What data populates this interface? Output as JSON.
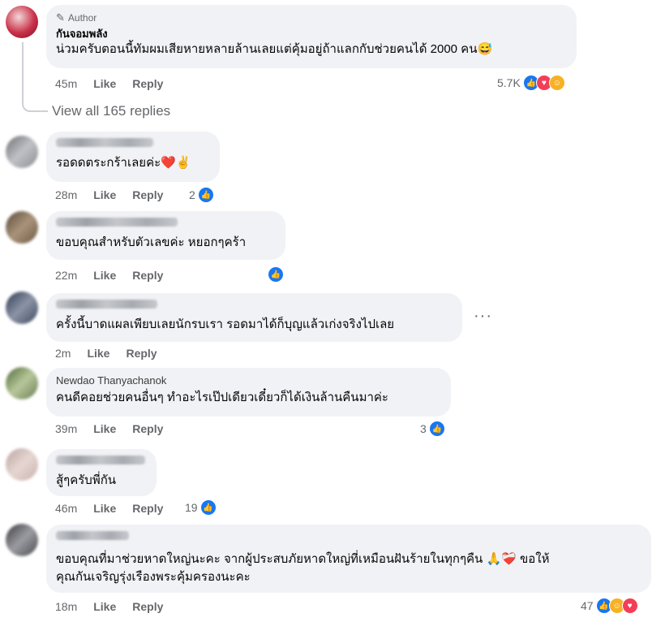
{
  "top_comment": {
    "author_tag": "Author",
    "author_name": "กันจอมพลัง",
    "text": "น่วมครับตอนนี้ทัมผมเสียหายหลายล้านเลยแต่คุ้มอยู่ถ้าแลกกับช่วยคนได้ 2000 คน😅",
    "time": "45m",
    "like_label": "Like",
    "reply_label": "Reply",
    "reaction_count": "5.7K",
    "reaction_icons": [
      "like-icon",
      "love-icon",
      "care-icon"
    ]
  },
  "view_replies": "View all 165 replies",
  "comments": [
    {
      "text": "รอดดตระกร้าเลยค่ะ❤️✌️",
      "time": "28m",
      "like": "Like",
      "reply": "Reply",
      "reaction_count": "2"
    },
    {
      "text": "ขอบคุณสำหรับตัวเลขค่ะ หยอกๆคร้า",
      "time": "22m",
      "like": "Like",
      "reply": "Reply",
      "reaction_count": ""
    },
    {
      "text": "ครั้งนี้บาดแผลเพียบเลยนักรบเรา รอดมาได้ก็บุญแล้วเก่งจริงไปเลย",
      "time": "2m",
      "like": "Like",
      "reply": "Reply",
      "more": "···"
    },
    {
      "name": "Newdao Thanyachanok",
      "text": "คนดีคอยช่วยคนอื่นๆ ทำอะไรเป๊ปเดียวเดี๋ยวก็ได้เงินล้านคืนมาค่ะ",
      "time": "39m",
      "like": "Like",
      "reply": "Reply",
      "reaction_count": "3"
    },
    {
      "text": "สู้ๆครับพี่กัน",
      "time": "46m",
      "like": "Like",
      "reply": "Reply",
      "reaction_count": "19"
    },
    {
      "text_line1": "ขอบคุณที่มาช่วยหาดใหญ่นะคะ จากผู้ประสบภัยหาดใหญ่ที่เหมือนฝันร้ายในทุกๆคืน 🙏❤️‍🩹 ขอให้",
      "text_line2": "คุณกันเจริญรุ่งเรืองพระคุ้มครองนะคะ",
      "time": "18m",
      "like": "Like",
      "reply": "Reply",
      "reaction_count": "47"
    }
  ],
  "colors": {
    "like": "#1877f2",
    "love": "#f33e58",
    "care": "#f7b125",
    "bubble": "#f0f2f5",
    "meta": "#65676b"
  }
}
